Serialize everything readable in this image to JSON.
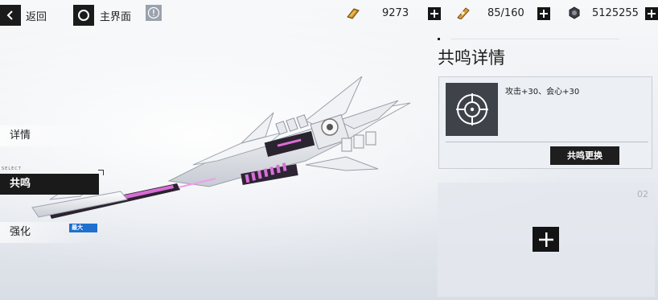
{
  "topbar": {
    "back_label": "返回",
    "home_label": "主界面",
    "resources": [
      {
        "icon": "gold-bar-icon",
        "value": "9273"
      },
      {
        "icon": "stamina-battery-icon",
        "value": "85/160"
      },
      {
        "icon": "coin-icon",
        "value": "5125255"
      }
    ]
  },
  "menu": {
    "select_tag": "SELECT",
    "items": [
      {
        "label": "详情"
      },
      {
        "label": "共鸣"
      },
      {
        "label": "强化"
      }
    ],
    "max_badge": "最大"
  },
  "panel": {
    "title": "共鸣详情",
    "slot1": {
      "effect": "攻击+30、会心+30",
      "button": "共鸣更换"
    },
    "slot2": {
      "number": "02"
    }
  },
  "colors": {
    "accent_dark": "#1a1a1a",
    "badge_blue": "#1f6fcf",
    "weapon_glow": "#e06ad8"
  }
}
